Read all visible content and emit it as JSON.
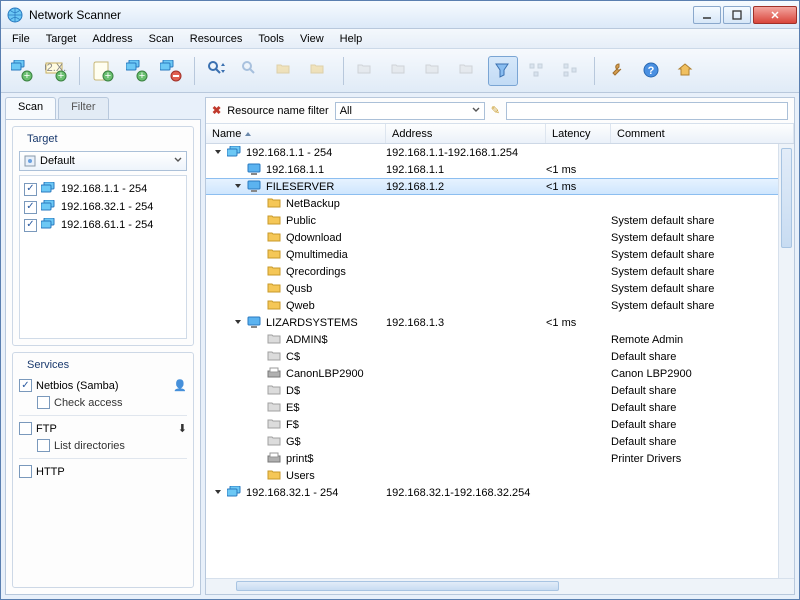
{
  "window": {
    "title": "Network Scanner"
  },
  "menu": [
    "File",
    "Target",
    "Address",
    "Scan",
    "Resources",
    "Tools",
    "View",
    "Help"
  ],
  "tabs": {
    "scan": "Scan",
    "filter": "Filter"
  },
  "target": {
    "title": "Target",
    "combo": "Default",
    "items": [
      {
        "checked": true,
        "label": "192.168.1.1 - 254"
      },
      {
        "checked": true,
        "label": "192.168.32.1 - 254"
      },
      {
        "checked": true,
        "label": "192.168.61.1 - 254"
      }
    ]
  },
  "services": {
    "title": "Services",
    "items": [
      {
        "checked": true,
        "label": "Netbios (Samba)",
        "sub": "Check access",
        "sub_checked": false
      },
      {
        "checked": false,
        "label": "FTP",
        "sub": "List directories",
        "sub_checked": false
      },
      {
        "checked": false,
        "label": "HTTP"
      }
    ]
  },
  "filterbar": {
    "label": "Resource name filter",
    "select": "All"
  },
  "columns": {
    "name": "Name",
    "address": "Address",
    "latency": "Latency",
    "comment": "Comment"
  },
  "rows": [
    {
      "depth": 0,
      "exp": "open",
      "icon": "groupmon",
      "name": "192.168.1.1 - 254",
      "address": "192.168.1.1-192.168.1.254"
    },
    {
      "depth": 1,
      "icon": "mon",
      "name": "192.168.1.1",
      "address": "192.168.1.1",
      "latency": "<1 ms"
    },
    {
      "depth": 1,
      "exp": "open",
      "icon": "mon",
      "name": "FILESERVER",
      "address": "192.168.1.2",
      "latency": "<1 ms",
      "sel": true
    },
    {
      "depth": 2,
      "icon": "folder",
      "name": "NetBackup"
    },
    {
      "depth": 2,
      "icon": "folder",
      "name": "Public",
      "comment": "System default share"
    },
    {
      "depth": 2,
      "icon": "folder",
      "name": "Qdownload",
      "comment": "System default share"
    },
    {
      "depth": 2,
      "icon": "folder",
      "name": "Qmultimedia",
      "comment": "System default share"
    },
    {
      "depth": 2,
      "icon": "folder",
      "name": "Qrecordings",
      "comment": "System default share"
    },
    {
      "depth": 2,
      "icon": "folder",
      "name": "Qusb",
      "comment": "System default share"
    },
    {
      "depth": 2,
      "icon": "folder",
      "name": "Qweb",
      "comment": "System default share"
    },
    {
      "depth": 1,
      "exp": "open",
      "icon": "mon",
      "name": "LIZARDSYSTEMS",
      "address": "192.168.1.3",
      "latency": "<1 ms"
    },
    {
      "depth": 2,
      "icon": "folderg",
      "name": "ADMIN$",
      "comment": "Remote Admin"
    },
    {
      "depth": 2,
      "icon": "folderg",
      "name": "C$",
      "comment": "Default share"
    },
    {
      "depth": 2,
      "icon": "printer",
      "name": "CanonLBP2900",
      "comment": "Canon LBP2900"
    },
    {
      "depth": 2,
      "icon": "folderg",
      "name": "D$",
      "comment": "Default share"
    },
    {
      "depth": 2,
      "icon": "folderg",
      "name": "E$",
      "comment": "Default share"
    },
    {
      "depth": 2,
      "icon": "folderg",
      "name": "F$",
      "comment": "Default share"
    },
    {
      "depth": 2,
      "icon": "folderg",
      "name": "G$",
      "comment": "Default share"
    },
    {
      "depth": 2,
      "icon": "printer",
      "name": "print$",
      "comment": "Printer Drivers"
    },
    {
      "depth": 2,
      "icon": "folder",
      "name": "Users"
    },
    {
      "depth": 0,
      "exp": "open",
      "icon": "groupmon",
      "name": "192.168.32.1 - 254",
      "address": "192.168.32.1-192.168.32.254"
    }
  ]
}
